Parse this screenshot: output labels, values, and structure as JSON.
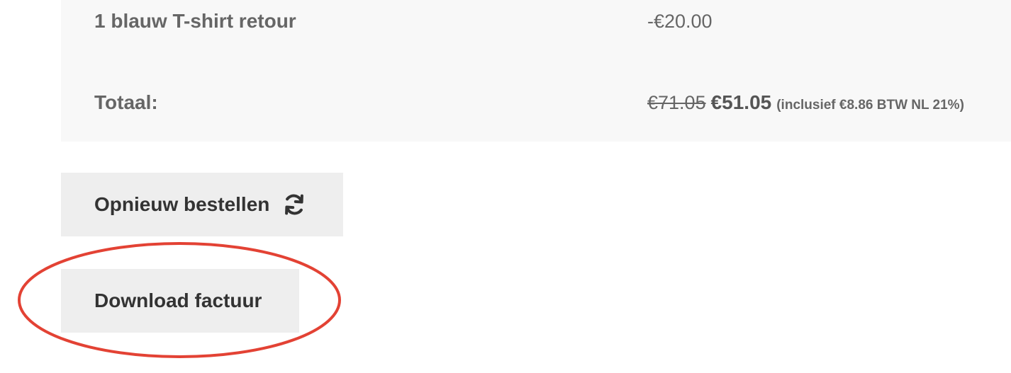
{
  "order_summary": {
    "return_row": {
      "label": "1 blauw T-shirt retour",
      "value": "-€20.00"
    },
    "total_row": {
      "label": "Totaal:",
      "original_price": "€71.05",
      "current_price": "€51.05",
      "tax_note": "(inclusief €8.86 BTW NL 21%)"
    }
  },
  "actions": {
    "reorder_label": "Opnieuw bestellen",
    "reorder_icon": "refresh-icon",
    "download_invoice_label": "Download factuur"
  },
  "colors": {
    "summary_background": "#f8f8f8",
    "button_background": "#eeeeee",
    "annotation_red": "#e34234"
  }
}
